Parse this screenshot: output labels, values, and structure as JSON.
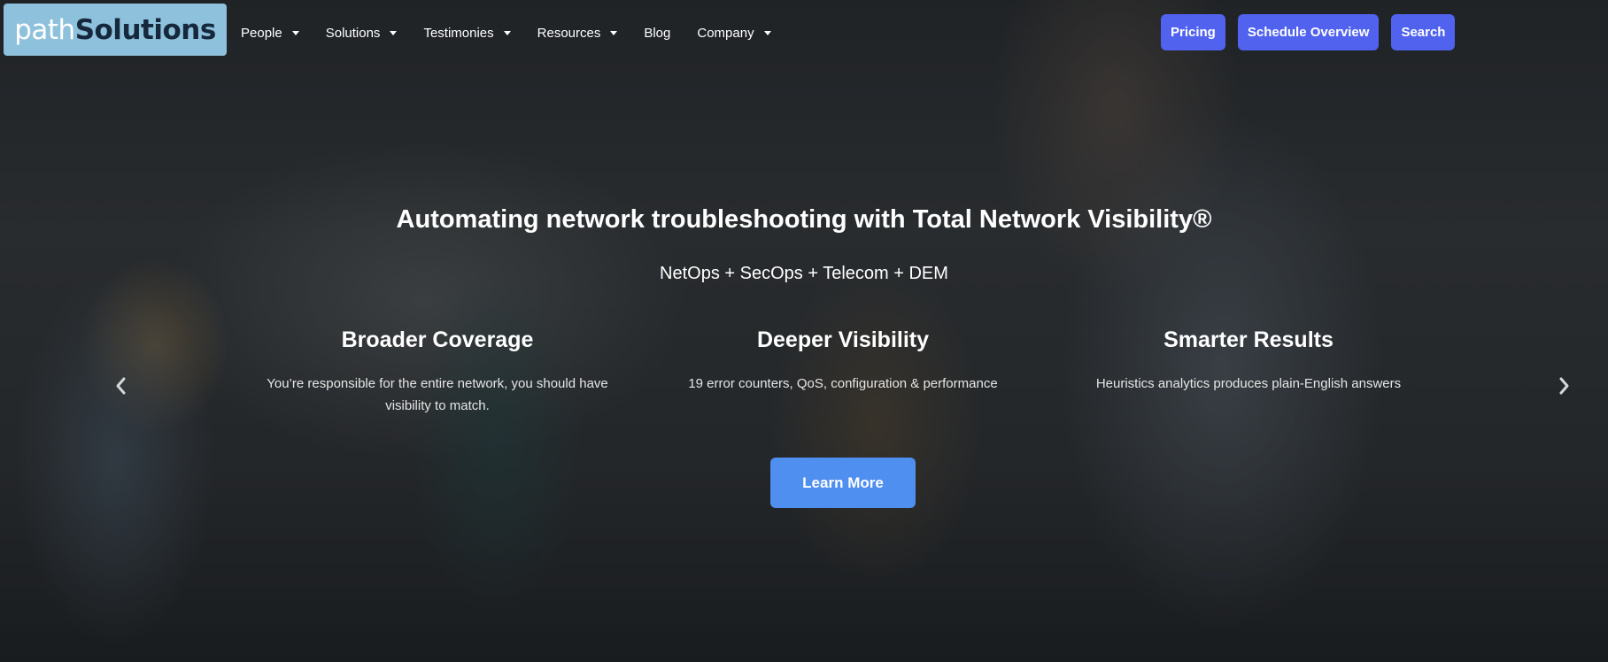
{
  "logo": {
    "text_prefix": "path",
    "text_brand": "Solutions"
  },
  "nav": {
    "items": [
      {
        "label": "People",
        "has_dropdown": true
      },
      {
        "label": "Solutions",
        "has_dropdown": true
      },
      {
        "label": "Testimonies",
        "has_dropdown": true
      },
      {
        "label": "Resources",
        "has_dropdown": true
      },
      {
        "label": "Blog",
        "has_dropdown": false
      },
      {
        "label": "Company",
        "has_dropdown": true
      }
    ]
  },
  "header_buttons": {
    "pricing": "Pricing",
    "schedule": "Schedule Overview",
    "search": "Search"
  },
  "hero": {
    "headline": "Automating network troubleshooting with Total Network Visibility®",
    "subhead": "NetOps + SecOps + Telecom + DEM",
    "features": [
      {
        "title": "Broader Coverage",
        "description": "You’re responsible for the entire network, you should have visibility to match."
      },
      {
        "title": "Deeper Visibility",
        "description": "19 error counters, QoS, configuration & performance"
      },
      {
        "title": "Smarter Results",
        "description": "Heuristics analytics produces plain-English answers"
      }
    ],
    "cta_label": "Learn More"
  },
  "carousel": {
    "prev_icon": "chevron-left-icon",
    "next_icon": "chevron-right-icon"
  },
  "colors": {
    "logo_bg": "#8ec1dc",
    "logo_brand": "#16283c",
    "header_button": "#5062ee",
    "cta_button": "#4f8ff0"
  }
}
